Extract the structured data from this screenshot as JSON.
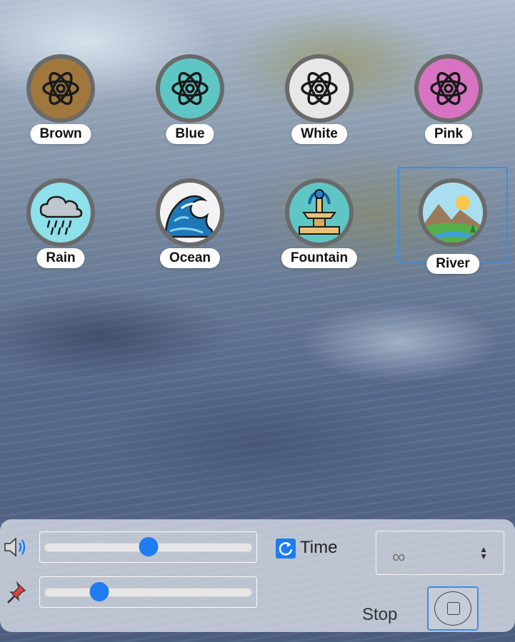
{
  "sounds": [
    {
      "label": "Brown",
      "icon": "atom-icon",
      "color": "#a0773d"
    },
    {
      "label": "Blue",
      "icon": "atom-icon",
      "color": "#5ec7c5"
    },
    {
      "label": "White",
      "icon": "atom-icon",
      "color": "#e7e7e7"
    },
    {
      "label": "Pink",
      "icon": "atom-icon",
      "color": "#d873c2"
    },
    {
      "label": "Rain",
      "icon": "rain-cloud-icon",
      "color": "#8ee0ea"
    },
    {
      "label": "Ocean",
      "icon": "wave-icon",
      "color": "#f2f2f2"
    },
    {
      "label": "Fountain",
      "icon": "fountain-icon",
      "color": "#5ec7c5"
    },
    {
      "label": "River",
      "icon": "river-landscape-icon",
      "color": "#cfe9ee",
      "selected": true
    }
  ],
  "controls": {
    "volume_level": 0.5,
    "pin_level": 0.25,
    "time_label": "Time",
    "time_value": "∞",
    "stop_label": "Stop"
  },
  "colors": {
    "accent": "#1e7cf0",
    "selection_border": "#3a8ee6"
  }
}
